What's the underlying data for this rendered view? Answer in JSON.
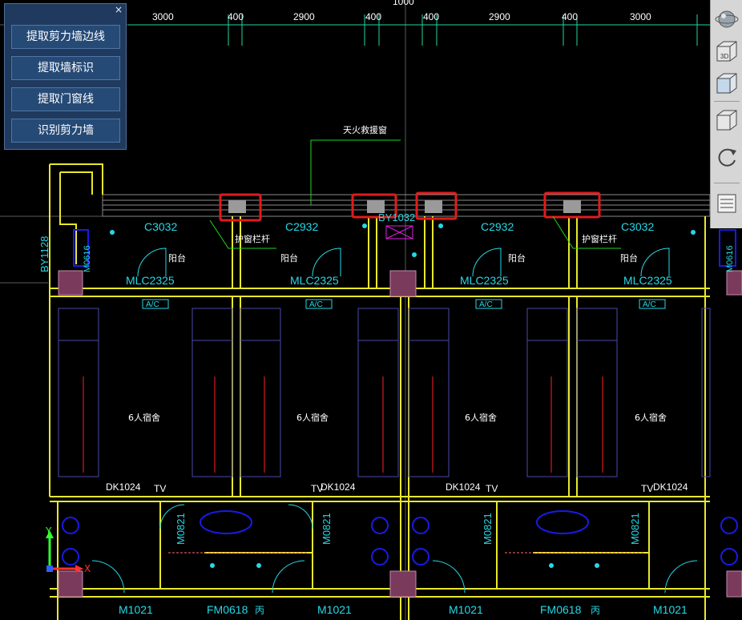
{
  "tool_panel": {
    "close_glyph": "×",
    "buttons": [
      "提取剪力墙边线",
      "提取墙标识",
      "提取门窗线",
      "识别剪力墙"
    ]
  },
  "view_toolbar": {
    "buttons": [
      {
        "name": "orbit-icon"
      },
      {
        "name": "3d-view-icon",
        "label": "3D"
      },
      {
        "name": "cube-view-icon"
      },
      {
        "name": "cube-single-icon"
      },
      {
        "name": "rotate-icon"
      },
      {
        "name": "layer-list-icon"
      }
    ]
  },
  "drawing": {
    "dimensions": [
      "3000",
      "400",
      "2900",
      "400",
      "400",
      "2900",
      "400",
      "3000"
    ],
    "top_partial": "1000",
    "windows": [
      "C3032",
      "C2932",
      "C2932",
      "C3032"
    ],
    "fire_window": "BY1032",
    "side_label": "BY1128",
    "fire_note": "天火救援窗",
    "railings": [
      "护窗栏杆",
      "护窗栏杆"
    ],
    "balconies": [
      "阳台",
      "阳台",
      "阳台",
      "阳台"
    ],
    "sliding_doors": [
      "MLC2325",
      "MLC2325",
      "MLC2325",
      "MLC2325"
    ],
    "ac_tags": [
      "A/C",
      "A/C",
      "A/C",
      "A/C"
    ],
    "rooms": [
      "6人宿舍",
      "6人宿舍",
      "6人宿舍",
      "6人宿舍"
    ],
    "dk_labels": [
      "DK1024",
      "DK1024",
      "DK1024",
      "DK1024"
    ],
    "tv_labels": [
      "TV",
      "TV",
      "TV",
      "TV"
    ],
    "m0821": [
      "M0821",
      "M0821",
      "M0821",
      "M0821"
    ],
    "side_door_labels": [
      "M0616",
      "M0616"
    ],
    "bottom_doors": [
      "M1021",
      "M1021",
      "M1021",
      "M1021"
    ],
    "fm_doors": [
      "FM0618",
      "FM0618"
    ],
    "bing": [
      "丙",
      "丙"
    ],
    "axis_x": "X",
    "axis_y": "Y"
  },
  "colors": {
    "background": "#000000",
    "wall": "#e8e82a",
    "text_cyan": "#25d9e6",
    "text_white": "#ffffff",
    "furniture": "#4a4aa8",
    "column": "#7a3a5c",
    "highlight": "#e11b1b",
    "dim_line": "#1fd6a2",
    "leader": "#1fd61f",
    "blue_fixture": "#1a1ae8"
  }
}
